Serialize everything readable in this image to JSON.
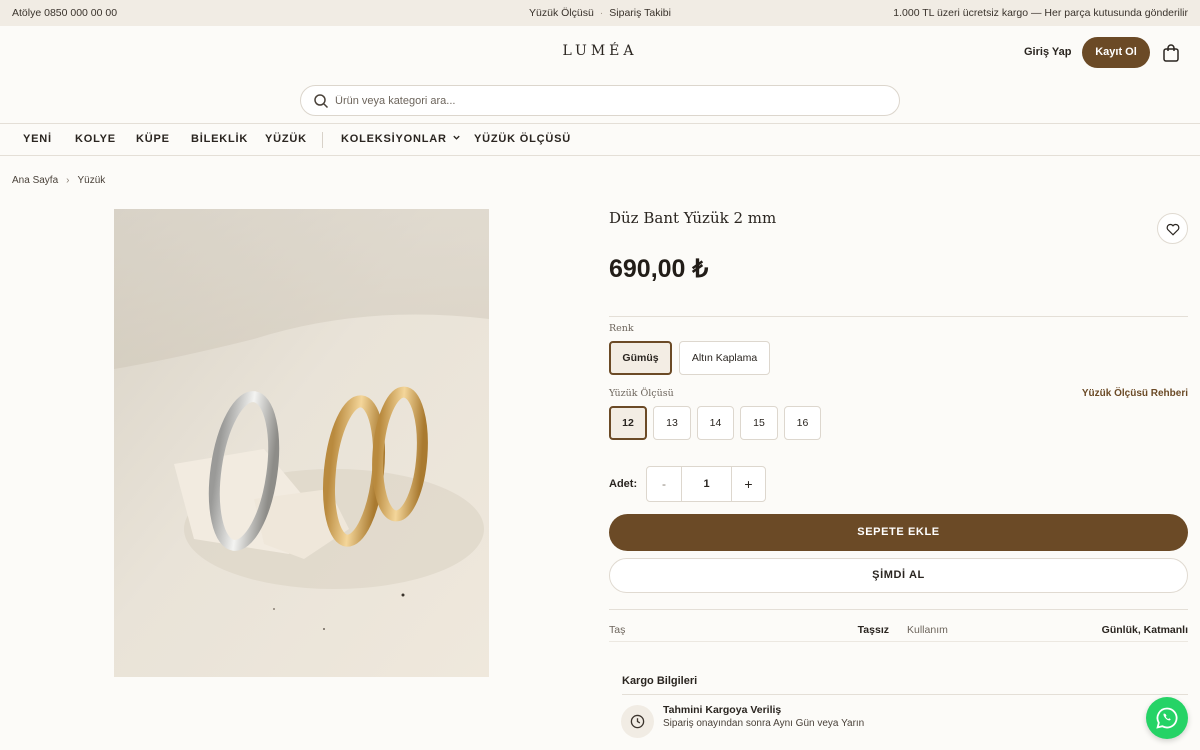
{
  "topbar": {
    "phone": "Atölye 0850 000 00 00",
    "links": [
      "Yüzük Ölçüsü",
      "Sipariş Takibi"
    ],
    "promo": "1.000 TL üzeri ücretsiz kargo — Her parça kutusunda gönderilir"
  },
  "header": {
    "logo": "LUMÉA",
    "login_label": "Giriş Yap",
    "signup_label": "Kayıt Ol",
    "cart_icon": "shopping-bag-icon"
  },
  "search": {
    "placeholder": "Ürün veya kategori ara...",
    "value": "",
    "icon": "search-icon"
  },
  "nav": {
    "items": [
      "YENİ",
      "KOLYE",
      "KÜPE",
      "BİLEKLİK",
      "YÜZÜK",
      "KOLEKSİYONLAR",
      "YÜZÜK ÖLÇÜSÜ"
    ]
  },
  "breadcrumb": {
    "items": [
      "Ana Sayfa",
      "Yüzük"
    ]
  },
  "product": {
    "title": "Düz Bant Yüzük 2 mm",
    "price": "690,00 ₺",
    "color_label": "Renk",
    "colors": [
      "Gümüş",
      "Altın Kaplama"
    ],
    "selected_color": "Gümüş",
    "size_label": "Yüzük Ölçüsü",
    "size_guide_label": "Yüzük Ölçüsü Rehberi",
    "sizes": [
      "12",
      "13",
      "14",
      "15",
      "16"
    ],
    "selected_size": "12",
    "quantity_label": "Adet:",
    "quantity": "1",
    "minus": "-",
    "plus": "+",
    "add_to_cart_label": "SEPETE EKLE",
    "buy_now_label": "ŞİMDİ AL",
    "specs": [
      {
        "label": "Taş",
        "value": "Taşsız"
      },
      {
        "label": "Kullanım",
        "value": "Günlük, Katmanlı"
      }
    ]
  },
  "shipping": {
    "title": "Kargo Bilgileri",
    "heading": "Tahmini Kargoya Veriliş",
    "text": "Sipariş onayından sonra Aynı Gün veya Yarın",
    "icon": "clock-icon"
  },
  "colors": {
    "accent": "#6b4a26",
    "background": "#fcfbf8",
    "topbar": "#f1ece4",
    "whatsapp": "#25d366"
  }
}
